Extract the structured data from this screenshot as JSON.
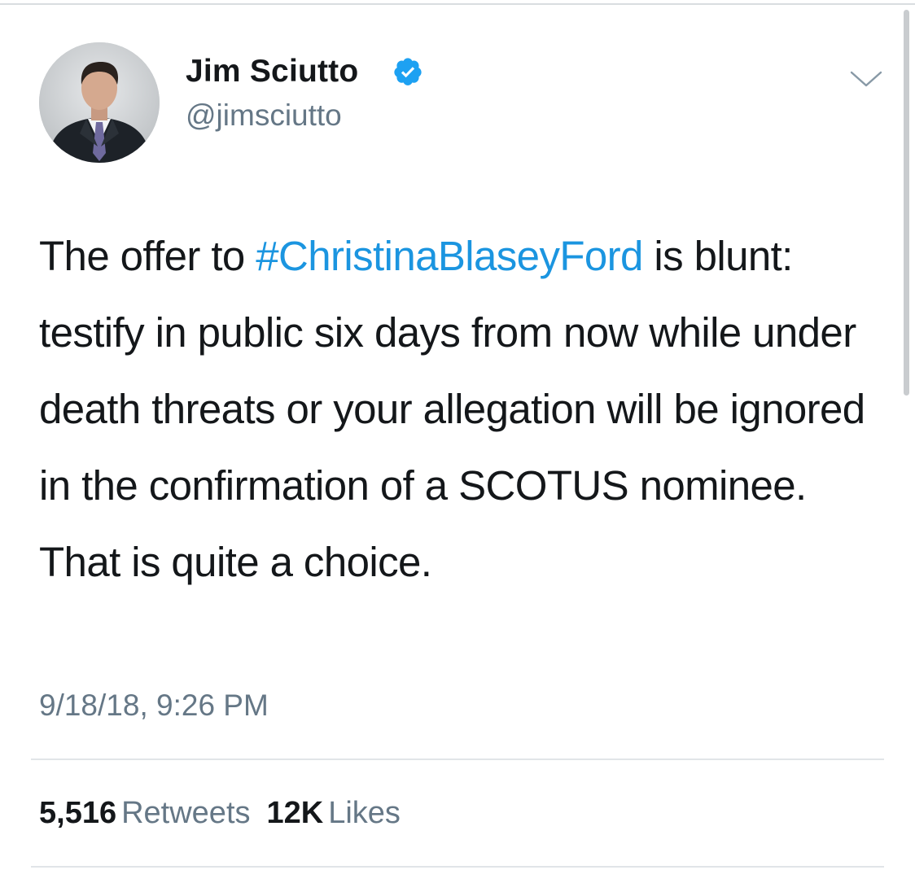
{
  "author": {
    "name": "Jim Sciutto",
    "handle": "@jimsciutto",
    "verified": true,
    "avatar_icon": "profile-photo",
    "verified_icon": "verified-badge-icon"
  },
  "menu": {
    "icon": "chevron-down-icon"
  },
  "tweet": {
    "text_before": "The offer to ",
    "hashtag": "#ChristinaBlaseyFord",
    "text_after": " is blunt: testify in public six days from now while under death threats or your allegation will be ignored in the confirmation of a SCOTUS nominee. That is quite a choice.",
    "timestamp": "9/18/18, 9:26 PM"
  },
  "stats": {
    "retweets_count": "5,516",
    "retweets_label": "Retweets",
    "likes_count": "12K",
    "likes_label": "Likes"
  },
  "colors": {
    "text": "#14171a",
    "secondary": "#657786",
    "link": "#1b95e0",
    "verified": "#1da1f2",
    "divider": "#e1e5e8"
  }
}
